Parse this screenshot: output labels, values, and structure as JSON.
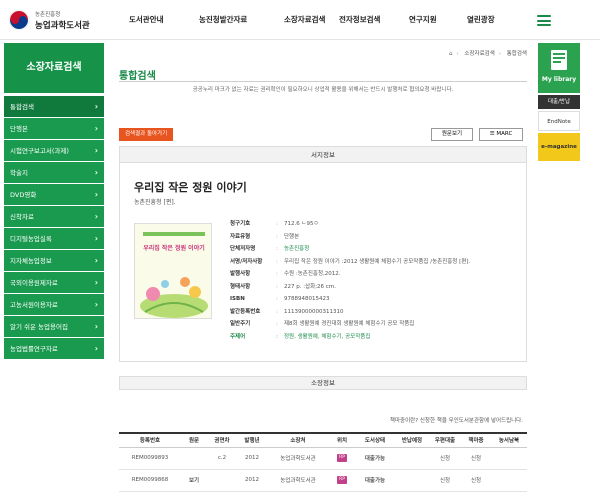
{
  "header": {
    "logo_sub": "농촌진흥청",
    "logo_main": "농업과학도서관",
    "nav": [
      "도서관안내",
      "농진청발간자료",
      "소장자료검색",
      "전자정보검색",
      "연구지원",
      "열린광장"
    ]
  },
  "sidebar": {
    "title": "소장자료검색",
    "items": [
      {
        "label": "통합검색",
        "active": true
      },
      {
        "label": "단행본"
      },
      {
        "label": "시험연구보고서(과제)"
      },
      {
        "label": "학술지"
      },
      {
        "label": "DVD영화"
      },
      {
        "label": "신착자료"
      },
      {
        "label": "디지털농업실록"
      },
      {
        "label": "지자체농업정보"
      },
      {
        "label": "국외이용원제자료"
      },
      {
        "label": "고농서원이용자료"
      },
      {
        "label": "알기 쉬운 농업용어집"
      },
      {
        "label": "농업법률연구자료"
      }
    ]
  },
  "quick": {
    "library_label": "My library",
    "loan_label": "대출/반납",
    "endnote_label": "EndNote",
    "emag_label": "e-magazine"
  },
  "breadcrumb": [
    "소장자료검색",
    "통합검색"
  ],
  "page_title": "통합검색",
  "notice": "공공누리 마크가 없는 자료는 권리확인이 필요하오니 상업적 활용을 위해서는 반드시 발행처로 협의요청 바랍니다.",
  "buttons": {
    "back": "검색결과 돌아가기",
    "original": "원문보기",
    "marc": "MARC"
  },
  "biblio": {
    "section_title": "서지정보",
    "book_title": "우리집 작은 정원 이야기",
    "author": "농촌진흥청 [편].",
    "cover_title": "우리집 작은 정원 이야기",
    "fields": [
      {
        "key": "청구기호",
        "value": "712.6 ㄴ95ㅇ"
      },
      {
        "key": "자료유형",
        "value": "단행본"
      },
      {
        "key": "단체저자명",
        "value": "농촌진흥청",
        "link": true
      },
      {
        "key": "서명/저자사항",
        "value": "우리집 작은 정원 이야기 :2012 생활원예 체험수기 공모작품집 /농촌진흥청 [편]."
      },
      {
        "key": "발행사항",
        "value": "수원 :농촌진흥청,2012."
      },
      {
        "key": "형태사항",
        "value": "227 p. :삽화;26 cm."
      },
      {
        "key": "ISBN",
        "value": "9788948015423"
      },
      {
        "key": "발간등록번호",
        "value": "11139000000311310"
      },
      {
        "key": "일반주기",
        "value": "제8회 생활원예 경진대회 생활원예 체험수기 공모 작품집"
      }
    ],
    "subject_key": "주제어",
    "subjects": [
      "정원",
      "생활원예",
      "체험수기",
      "공모작품집"
    ]
  },
  "holdings": {
    "section_title": "소장정보",
    "notice": "책마중이란? 신청한 책을 무인도서분관함에 넣어드립니다.",
    "columns": [
      "등록번호",
      "원문",
      "권면차",
      "발행년",
      "소장처",
      "위치",
      "도서상태",
      "반납예정",
      "우편대출",
      "책마중",
      "농서남북"
    ],
    "rows": [
      [
        "REM0099893",
        "",
        "c.2",
        "2012",
        "농업과학도서관",
        "RP",
        "대출가능",
        "",
        "신청",
        "신청",
        ""
      ],
      [
        "REM0099868",
        "보기",
        "",
        "2012",
        "농업과학도서관",
        "RP",
        "대출가능",
        "",
        "신청",
        "신청",
        ""
      ]
    ]
  },
  "colors": {
    "brand_green": "#1a9a4f",
    "accent_orange": "#e8541e",
    "emag_yellow": "#f2c81a",
    "rp_badge": "#c0408a"
  }
}
